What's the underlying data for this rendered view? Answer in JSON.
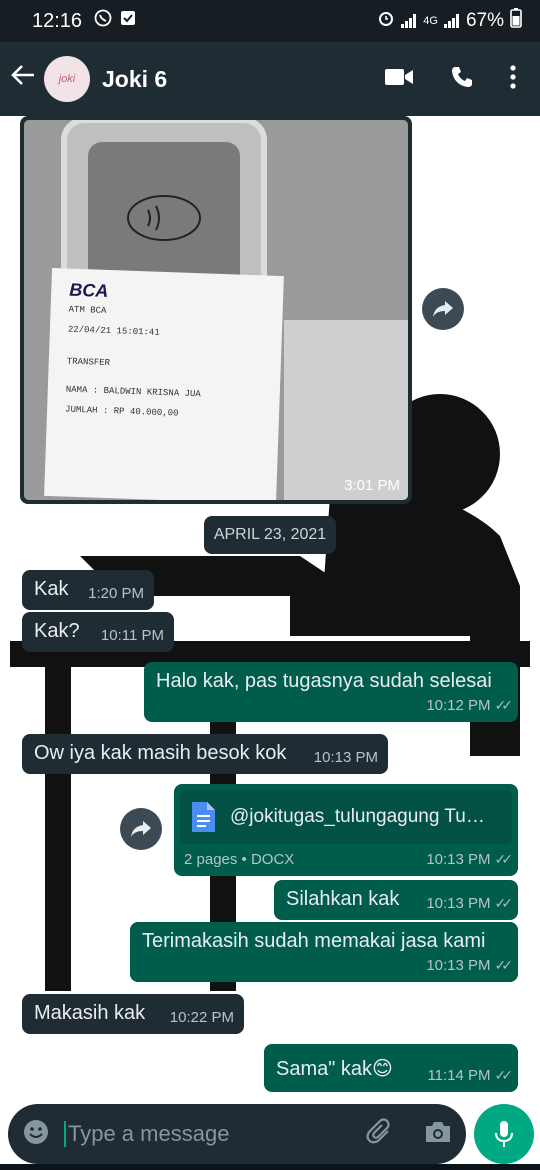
{
  "status_bar": {
    "time": "12:16",
    "network": "4G",
    "battery": "67%"
  },
  "header": {
    "back": "←",
    "contact_name": "Joki 6",
    "avatar_text": "joki"
  },
  "image_message": {
    "time": "3:01 PM",
    "receipt_bank": "BCA",
    "receipt_lines": [
      "ATM BCA",
      "22/04/21   15:01:41",
      "TRANSFER",
      "NAMA : BALDWIN KRISNA JUA",
      "JUMLAH : RP 40.000,00"
    ]
  },
  "date_chip": "APRIL 23, 2021",
  "messages": [
    {
      "text": "Kak",
      "time": "1:20 PM"
    },
    {
      "text": "Kak?",
      "time": "10:11 PM"
    },
    {
      "text": "Halo kak, pas tugasnya sudah selesai",
      "time": "10:12 PM"
    },
    {
      "text": "Ow iya kak masih besok kok",
      "time": "10:13 PM"
    },
    {
      "file_name": "@jokitugas_tulungagung Tu…",
      "file_meta": "2 pages • DOCX",
      "time": "10:13 PM"
    },
    {
      "text": "Silahkan kak",
      "time": "10:13 PM"
    },
    {
      "text": "Terimakasih sudah memakai jasa kami",
      "time": "10:13 PM"
    },
    {
      "text": "Makasih kak",
      "time": "10:22 PM"
    },
    {
      "text": "Sama\" kak😊",
      "time": "11:14 PM"
    }
  ],
  "input": {
    "placeholder": "Type a message"
  },
  "colors": {
    "incoming": "#1f2c34",
    "outgoing": "#005c4b",
    "accent": "#00a884"
  },
  "icons": [
    "back-arrow-icon",
    "video-call-icon",
    "phone-icon",
    "more-options-icon",
    "forward-icon",
    "document-icon",
    "emoji-icon",
    "attach-icon",
    "camera-icon",
    "mic-icon"
  ]
}
